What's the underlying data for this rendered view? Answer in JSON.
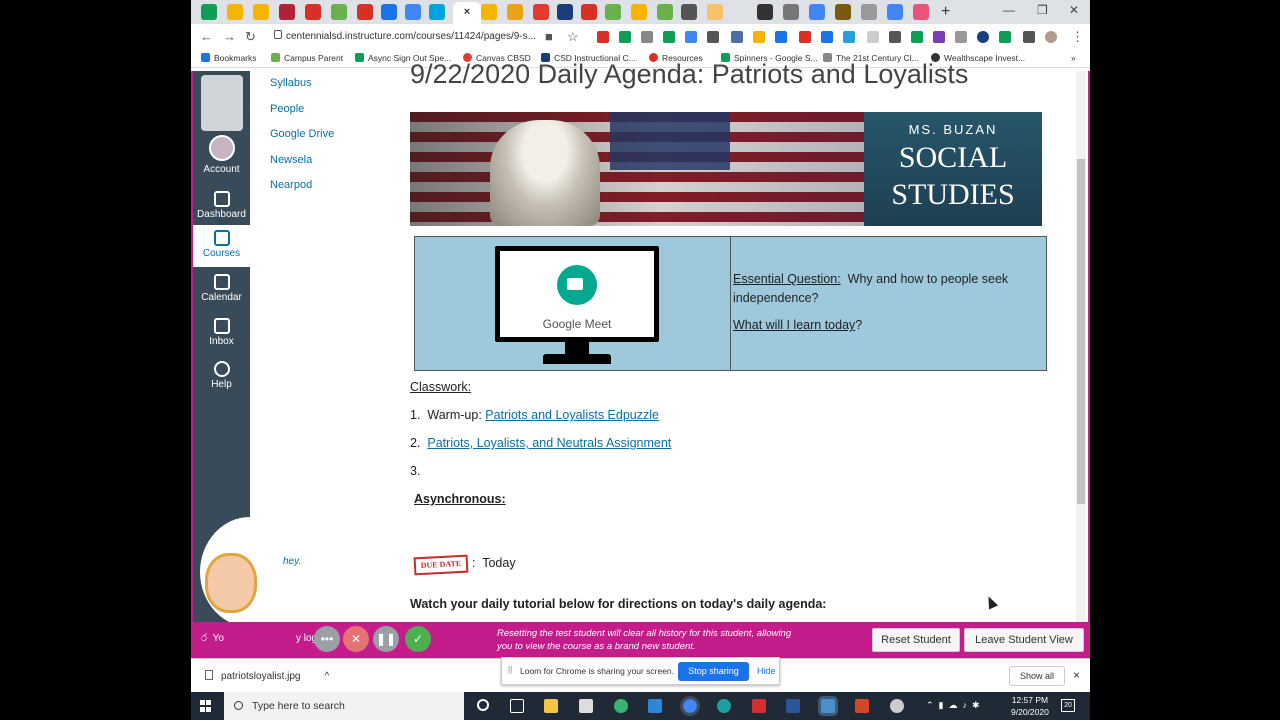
{
  "browser": {
    "url": "centennialsd.instructure.com/courses/11424/pages/9-s...",
    "active_tab_close": "×",
    "new_tab": "+",
    "bookmarks": [
      {
        "label": "Bookmarks",
        "color": "#1a73e8"
      },
      {
        "label": "Campus Parent",
        "color": "#6ab04c"
      },
      {
        "label": "Async Sign Out Spe...",
        "color": "#0f9d58"
      },
      {
        "label": "Canvas CBSD",
        "color": "#e03c31"
      },
      {
        "label": "CSD Instructional C...",
        "color": "#1a3d7c"
      },
      {
        "label": "Resources",
        "color": "#d93025"
      },
      {
        "label": "Spinners - Google S...",
        "color": "#0f9d58"
      },
      {
        "label": "The 21st Century Cl...",
        "color": "#888888"
      },
      {
        "label": "Wealthscape Invest...",
        "color": "#333333"
      }
    ]
  },
  "global_nav": {
    "items": [
      {
        "label": "Account"
      },
      {
        "label": "Dashboard"
      },
      {
        "label": "Courses"
      },
      {
        "label": "Calendar"
      },
      {
        "label": "Inbox"
      },
      {
        "label": "Help"
      }
    ]
  },
  "course_nav": {
    "items": [
      "Syllabus",
      "People",
      "Google Drive",
      "Newsela",
      "Nearpod"
    ]
  },
  "page": {
    "title": "9/22/2020 Daily Agenda: Patriots and Loyalists",
    "banner": {
      "line1": "MS. BUZAN",
      "line2": "SOCIAL",
      "line3": "STUDIES"
    },
    "meet_label": "Google Meet",
    "essential_question_label": "Essential Question:",
    "essential_question_text": "  Why and how to people seek independence?",
    "learn_label": "What will I learn today",
    "learn_suffix": "?",
    "classwork_heading": "Classwork:",
    "items": [
      {
        "num": "1.",
        "prefix": "Warm-up: ",
        "link": "Patriots and Loyalists Edpuzzle"
      },
      {
        "num": "2.",
        "prefix": "",
        "link": "Patriots, Loyalists, and Neutrals Assignment"
      },
      {
        "num": "3.",
        "prefix": "",
        "link": ""
      }
    ],
    "async_heading": "Asynchronous:",
    "due_stamp": "DUE DATE",
    "due_sep": ":",
    "due_text": "Today",
    "tutorial_text": "Watch your daily tutorial below for directions on today's daily agenda:"
  },
  "bitmoji": {
    "hey": "hey."
  },
  "student_view": {
    "left_text": "Yo",
    "left_text2": "y log",
    "message": "Resetting the test student will clear all history for this student, allowing you to view the course as a brand new student.",
    "reset_label": "Reset Student",
    "leave_label": "Leave Student View"
  },
  "loom": {
    "message": "Loom for Chrome is sharing your screen.",
    "stop_label": "Stop sharing",
    "hide_label": "Hide"
  },
  "downloads": {
    "file": "patriotsloyalist.jpg",
    "show_all": "Show all",
    "close": "×"
  },
  "taskbar": {
    "search_placeholder": "Type here to search",
    "time": "12:57 PM",
    "date": "9/20/2020",
    "notif_count": "20"
  }
}
